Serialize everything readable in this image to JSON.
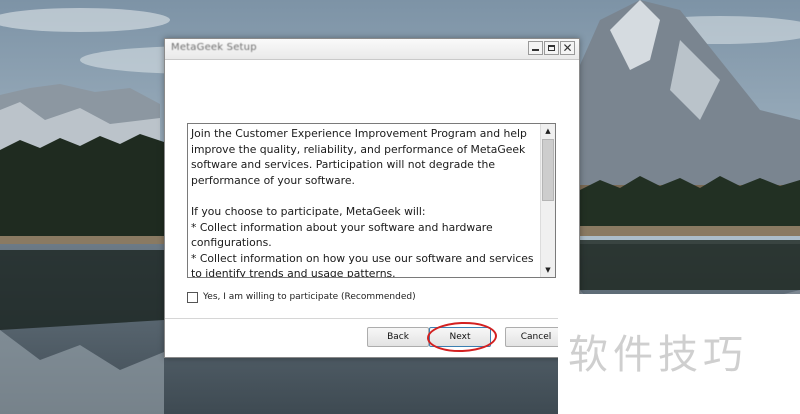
{
  "colors": {
    "sky": "#8fa4b4",
    "mountain": "#7e8a96",
    "forest": "#223322",
    "annotation_ring": "#d32020",
    "watermark": "#cfcfcf"
  },
  "window": {
    "title": "MetaGeek Setup",
    "controls": {
      "minimize_icon": "minimize-icon",
      "maximize_icon": "maximize-icon",
      "close_symbol": "✕"
    },
    "license_text": "Join the Customer Experience Improvement Program and help improve the quality, reliability, and performance of MetaGeek software and services. Participation will not degrade the performance of your software.\n\nIf you choose to participate, MetaGeek will:\n* Collect information about your software and hardware configurations.\n* Collect information on how you use our software and services to identify trends and usage patterns.",
    "scrollbar": {
      "up_arrow": "▲",
      "down_arrow": "▼"
    },
    "checkbox": {
      "label": "Yes, I am willing to participate (Recommended)",
      "checked": false
    },
    "buttons": {
      "back": "Back",
      "next": "Next",
      "cancel": "Cancel"
    }
  },
  "watermark": {
    "text": "软件技巧"
  }
}
